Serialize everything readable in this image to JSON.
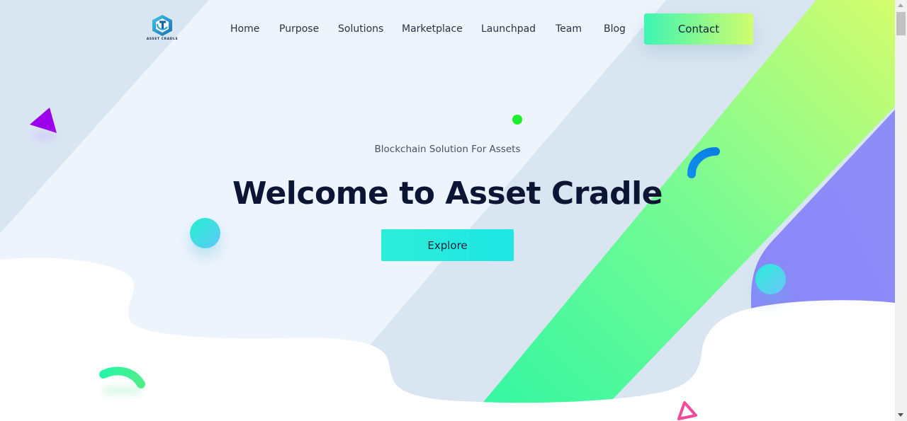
{
  "brand": {
    "logo_text": "ASSET CRADLE",
    "logo_icon": "asset-cradle-logo-icon"
  },
  "nav": {
    "items": [
      {
        "label": "Home"
      },
      {
        "label": "Purpose"
      },
      {
        "label": "Solutions"
      },
      {
        "label": "Marketplace"
      },
      {
        "label": "Launchpad"
      },
      {
        "label": "Team"
      },
      {
        "label": "Blog"
      }
    ],
    "contact_label": "Contact"
  },
  "hero": {
    "subtitle": "Blockchain Solution For Assets",
    "title": "Welcome to Asset Cradle",
    "cta_label": "Explore"
  },
  "colors": {
    "primary_text": "#0d1535",
    "accent_teal": "#1fe6e6",
    "accent_green": "#3df5b4",
    "accent_lime": "#d2fc6c",
    "accent_purple": "#8a85f9",
    "triangle_purple": "#9b00ea",
    "triangle_pink": "#f2499a",
    "arc_blue": "#0b86e8"
  }
}
